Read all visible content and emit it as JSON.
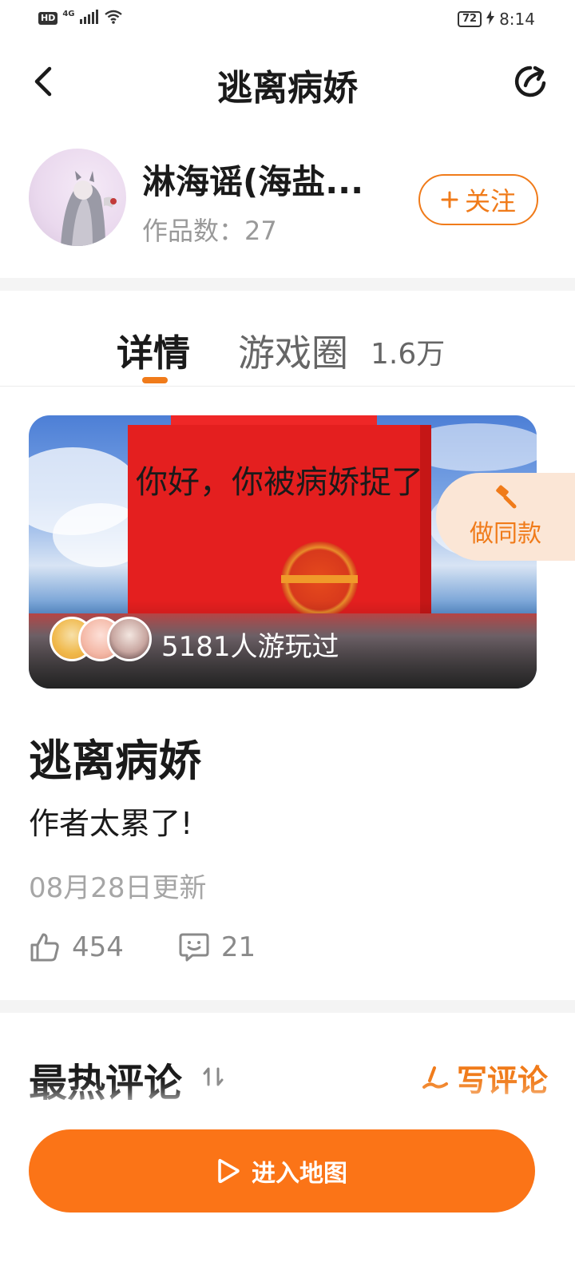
{
  "status_bar": {
    "hd": "HD",
    "network": "4G",
    "battery": "72",
    "time": "8:14"
  },
  "header": {
    "title": "逃离病娇",
    "back_icon": "chevron-left-icon",
    "share_icon": "share-icon"
  },
  "author": {
    "name": "淋海谣(海盐...",
    "works_label": "作品数：",
    "works_count": "27",
    "follow_label": "关注"
  },
  "tabs": {
    "details": "详情",
    "circle": "游戏圈",
    "circle_count": "1.6万"
  },
  "banner": {
    "text": "你好，你被病娇捉了",
    "players": "5181人游玩过",
    "make_same": "做同款"
  },
  "game": {
    "title": "逃离病娇",
    "description": "作者太累了!",
    "updated": "08月28日更新",
    "likes": "454",
    "comments": "21"
  },
  "comments_section": {
    "title": "最热评论",
    "sort_icon": "sort-icon",
    "write": "写评论"
  },
  "bottom": {
    "enter": "进入地图"
  },
  "colors": {
    "accent": "#f07b1a",
    "button": "#fb7417"
  }
}
